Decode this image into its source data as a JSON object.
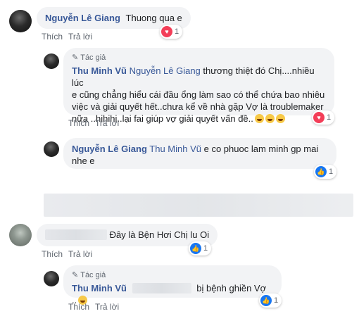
{
  "colors": {
    "link": "#385898",
    "bubble": "#f2f3f5",
    "heart": "#f33e58",
    "like": "#1877f2"
  },
  "comments": [
    {
      "author": "Nguyễn Lê Giang",
      "text": "Thuong qua e",
      "actions": [
        "Thích",
        "Trả lời"
      ],
      "reaction": {
        "icon": "heart-icon",
        "count": "1"
      }
    },
    {
      "author_tag": "Tác giả",
      "author": "Thu Minh Vũ",
      "mention": "Nguyễn Lê Giang",
      "text_l1": "thương thiệt đó Chị....nhiều lúc",
      "text_l2": "e cũng chẳng hiểu cái đầu ổng làm sao có thể chứa bao nhiêu",
      "text_l3": "việc và giải quyết hết..chưa kể về nhà gặp Vợ là troublemaker",
      "text_l4": "nữa ..hihihi..lại fai giúp vợ giải quyết vấn đề..",
      "actions": [
        "Thích",
        "Trả lời"
      ],
      "reaction": {
        "icon": "heart-icon",
        "count": "1"
      }
    },
    {
      "author": "Nguyễn Lê Giang",
      "mention": "Thu Minh Vũ",
      "text_l1": "e co phuoc lam minh gp mai",
      "text_l2": "nhe e",
      "reaction": {
        "icon": "like-icon",
        "count": "1"
      }
    },
    {
      "text": "Đây là Bện Hơi Chị lu Oi",
      "actions": [
        "Thích",
        "Trả lời"
      ],
      "reaction": {
        "icon": "like-icon",
        "count": "1"
      }
    },
    {
      "author_tag": "Tác giả",
      "author": "Thu Minh Vũ",
      "text": "bị bệnh ghiền Vợ ..",
      "actions": [
        "Thích",
        "Trả lời"
      ],
      "reaction": {
        "icon": "like-icon",
        "count": "1"
      }
    }
  ]
}
